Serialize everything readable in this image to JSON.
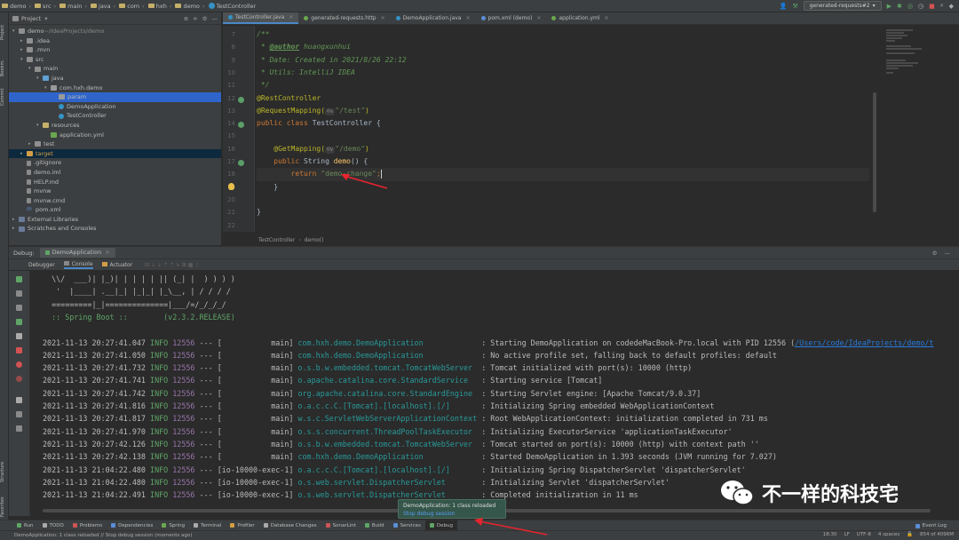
{
  "navbar": {
    "crumbs": [
      "demo",
      "src",
      "main",
      "java",
      "com",
      "hxh",
      "demo",
      "TestController"
    ],
    "run_config": "generated-requests#2"
  },
  "left_stripe": {
    "project": "Project",
    "bookmarks": "Bookmarks",
    "commit": "Commit",
    "structure": "Structure",
    "favorites": "Favorites"
  },
  "project_panel": {
    "title": "Project",
    "tree": [
      {
        "label": "demo",
        "suffix": " ~/IdeaProjects/demo",
        "indent": 0,
        "arrow": "v",
        "icon": "folder"
      },
      {
        "label": ".idea",
        "indent": 1,
        "arrow": ">",
        "icon": "folder"
      },
      {
        "label": ".mvn",
        "indent": 1,
        "arrow": ">",
        "icon": "folder"
      },
      {
        "label": "src",
        "indent": 1,
        "arrow": "v",
        "icon": "folder"
      },
      {
        "label": "main",
        "indent": 2,
        "arrow": "v",
        "icon": "folder"
      },
      {
        "label": "java",
        "indent": 3,
        "arrow": "v",
        "icon": "src"
      },
      {
        "label": "com.hxh.demo",
        "indent": 4,
        "arrow": "v",
        "icon": "pkg"
      },
      {
        "label": "param",
        "indent": 5,
        "arrow": "",
        "icon": "pkg",
        "selected": true
      },
      {
        "label": "DemoApplication",
        "indent": 5,
        "arrow": "",
        "icon": "cls"
      },
      {
        "label": "TestController",
        "indent": 5,
        "arrow": "",
        "icon": "cls"
      },
      {
        "label": "resources",
        "indent": 3,
        "arrow": "v",
        "icon": "res"
      },
      {
        "label": "application.yml",
        "indent": 4,
        "arrow": "",
        "icon": "yml"
      },
      {
        "label": "test",
        "indent": 2,
        "arrow": ">",
        "icon": "folder"
      },
      {
        "label": "target",
        "indent": 1,
        "arrow": ">",
        "icon": "target",
        "highlight": true
      },
      {
        "label": ".gitignore",
        "indent": 1,
        "arrow": "",
        "icon": "file"
      },
      {
        "label": "demo.iml",
        "indent": 1,
        "arrow": "",
        "icon": "file"
      },
      {
        "label": "HELP.md",
        "indent": 1,
        "arrow": "",
        "icon": "file"
      },
      {
        "label": "mvnw",
        "indent": 1,
        "arrow": "",
        "icon": "file"
      },
      {
        "label": "mvnw.cmd",
        "indent": 1,
        "arrow": "",
        "icon": "file"
      },
      {
        "label": "pom.xml",
        "indent": 1,
        "arrow": "",
        "icon": "m"
      },
      {
        "label": "External Libraries",
        "indent": 0,
        "arrow": ">",
        "icon": "lib"
      },
      {
        "label": "Scratches and Consoles",
        "indent": 0,
        "arrow": ">",
        "icon": "lib"
      }
    ]
  },
  "editor": {
    "tabs": [
      {
        "label": "TestController.java",
        "active": true
      },
      {
        "label": "generated-requests.http"
      },
      {
        "label": "DemoApplication.java"
      },
      {
        "label": "pom.xml (demo)"
      },
      {
        "label": "application.yml"
      }
    ],
    "lines": [
      {
        "n": "7",
        "html": "/**",
        "cls": "doc"
      },
      {
        "n": "8",
        "parts": [
          [
            " * ",
            "c-doc"
          ],
          [
            "@author",
            "c-tag"
          ],
          [
            " huangxunhui",
            "c-doc"
          ]
        ]
      },
      {
        "n": "9",
        "parts": [
          [
            " * Date: Created in 2021/8/26 22:12",
            "c-doc"
          ]
        ]
      },
      {
        "n": "10",
        "parts": [
          [
            " * Utils: IntelliJ IDEA",
            "c-doc"
          ]
        ]
      },
      {
        "n": "11",
        "parts": [
          [
            " */",
            "c-doc"
          ]
        ]
      },
      {
        "n": "12",
        "parts": [
          [
            "@RestController",
            "c-ann"
          ]
        ],
        "gutter": true
      },
      {
        "n": "13",
        "parts": [
          [
            "@RequestMapping(",
            "c-ann"
          ],
          [
            "©∨",
            "c-hint"
          ],
          [
            "\"/test\"",
            "c-str"
          ],
          [
            ")",
            "c-ann"
          ]
        ]
      },
      {
        "n": "14",
        "parts": [
          [
            "public class ",
            "c-kw"
          ],
          [
            "TestController {",
            "c-id"
          ]
        ],
        "gutter": true
      },
      {
        "n": "15",
        "parts": [
          [
            "",
            "c-id"
          ]
        ]
      },
      {
        "n": "16",
        "parts": [
          [
            "    @GetMapping(",
            "c-ann"
          ],
          [
            "©∨",
            "c-hint"
          ],
          [
            "\"/demo\"",
            "c-str"
          ],
          [
            ")",
            "c-ann"
          ]
        ]
      },
      {
        "n": "17",
        "parts": [
          [
            "    public ",
            "c-kw"
          ],
          [
            "String ",
            "c-id"
          ],
          [
            "demo",
            "c-fn"
          ],
          [
            "() {",
            "c-id"
          ]
        ],
        "gutter": true
      },
      {
        "n": "18",
        "parts": [
          [
            "        return ",
            "c-kw"
          ],
          [
            "\"demo-change\"",
            "c-str"
          ],
          [
            ";",
            "c-kw"
          ]
        ],
        "current": true
      },
      {
        "n": "19",
        "parts": [
          [
            "    }",
            "c-id"
          ]
        ]
      },
      {
        "n": "20",
        "parts": [
          [
            "",
            "c-id"
          ]
        ]
      },
      {
        "n": "21",
        "parts": [
          [
            "}",
            "c-id"
          ]
        ]
      },
      {
        "n": "22",
        "parts": [
          [
            "",
            "c-id"
          ]
        ]
      }
    ],
    "breadcrumb": [
      "TestController",
      "demo()"
    ]
  },
  "debug": {
    "label": "Debug:",
    "session": "DemoApplication",
    "subtabs": [
      "Debugger",
      "Console",
      "Actuator"
    ],
    "banner": [
      "  \\\\/  ___)| |_)| | | | | || (_| |  ) ) ) )",
      "   '  |____| .__|_| |_|_| |_\\__, | / / / /",
      "  =========|_|==============|___/=/_/_/_/",
      "  :: Spring Boot ::        (v2.3.2.RELEASE)"
    ],
    "logs": [
      {
        "ts": "2021-11-13 20:27:41.047",
        "lvl": "INFO",
        "pid": "12556",
        "thread": "[           main]",
        "logger": "com.hxh.demo.DemoApplication            ",
        "msg": ": Starting DemoApplication on codedeMacBook-Pro.local with PID 12556 (",
        "link": "/Users/code/IdeaProjects/demo/t"
      },
      {
        "ts": "2021-11-13 20:27:41.050",
        "lvl": "INFO",
        "pid": "12556",
        "thread": "[           main]",
        "logger": "com.hxh.demo.DemoApplication            ",
        "msg": ": No active profile set, falling back to default profiles: default"
      },
      {
        "ts": "2021-11-13 20:27:41.732",
        "lvl": "INFO",
        "pid": "12556",
        "thread": "[           main]",
        "logger": "o.s.b.w.embedded.tomcat.TomcatWebServer ",
        "msg": ": Tomcat initialized with port(s): 10000 (http)"
      },
      {
        "ts": "2021-11-13 20:27:41.741",
        "lvl": "INFO",
        "pid": "12556",
        "thread": "[           main]",
        "logger": "o.apache.catalina.core.StandardService  ",
        "msg": ": Starting service [Tomcat]"
      },
      {
        "ts": "2021-11-13 20:27:41.742",
        "lvl": "INFO",
        "pid": "12556",
        "thread": "[           main]",
        "logger": "org.apache.catalina.core.StandardEngine ",
        "msg": ": Starting Servlet engine: [Apache Tomcat/9.0.37]"
      },
      {
        "ts": "2021-11-13 20:27:41.816",
        "lvl": "INFO",
        "pid": "12556",
        "thread": "[           main]",
        "logger": "o.a.c.c.C.[Tomcat].[localhost].[/]      ",
        "msg": ": Initializing Spring embedded WebApplicationContext"
      },
      {
        "ts": "2021-11-13 20:27:41.817",
        "lvl": "INFO",
        "pid": "12556",
        "thread": "[           main]",
        "logger": "w.s.c.ServletWebServerApplicationContext",
        "msg": ": Root WebApplicationContext: initialization completed in 731 ms"
      },
      {
        "ts": "2021-11-13 20:27:41.970",
        "lvl": "INFO",
        "pid": "12556",
        "thread": "[           main]",
        "logger": "o.s.s.concurrent.ThreadPoolTaskExecutor ",
        "msg": ": Initializing ExecutorService 'applicationTaskExecutor'"
      },
      {
        "ts": "2021-11-13 20:27:42.126",
        "lvl": "INFO",
        "pid": "12556",
        "thread": "[           main]",
        "logger": "o.s.b.w.embedded.tomcat.TomcatWebServer ",
        "msg": ": Tomcat started on port(s): 10000 (http) with context path ''"
      },
      {
        "ts": "2021-11-13 20:27:42.138",
        "lvl": "INFO",
        "pid": "12556",
        "thread": "[           main]",
        "logger": "com.hxh.demo.DemoApplication            ",
        "msg": ": Started DemoApplication in 1.393 seconds (JVM running for 7.027)"
      },
      {
        "ts": "2021-11-13 21:04:22.480",
        "lvl": "INFO",
        "pid": "12556",
        "thread": "[io-10000-exec-1]",
        "logger": "o.a.c.c.C.[Tomcat].[localhost].[/]      ",
        "msg": ": Initializing Spring DispatcherServlet 'dispatcherServlet'"
      },
      {
        "ts": "2021-11-13 21:04:22.480",
        "lvl": "INFO",
        "pid": "12556",
        "thread": "[io-10000-exec-1]",
        "logger": "o.s.web.servlet.DispatcherServlet       ",
        "msg": ": Initializing Servlet 'dispatcherServlet'"
      },
      {
        "ts": "2021-11-13 21:04:22.491",
        "lvl": "INFO",
        "pid": "12556",
        "thread": "[io-10000-exec-1]",
        "logger": "o.s.web.servlet.DispatcherServlet       ",
        "msg": ": Completed initialization in 11 ms"
      }
    ]
  },
  "bottom_tools": [
    {
      "label": "Run",
      "color": "#5fa567"
    },
    {
      "label": "TODO",
      "color": "#aaaaaa"
    },
    {
      "label": "Problems",
      "color": "#cc5555"
    },
    {
      "label": "Dependencies",
      "color": "#5b8dd6"
    },
    {
      "label": "Spring",
      "color": "#6aa84f"
    },
    {
      "label": "Terminal",
      "color": "#aaaaaa"
    },
    {
      "label": "Profiler",
      "color": "#d49e46"
    },
    {
      "label": "Database Changes",
      "color": "#aaaaaa"
    },
    {
      "label": "SonarLint",
      "color": "#cc5555"
    },
    {
      "label": "Build",
      "color": "#5fa567"
    },
    {
      "label": "Services",
      "color": "#5b8dd6"
    },
    {
      "label": "Debug",
      "color": "#5fa567",
      "active": true
    }
  ],
  "event_log": "Event Log",
  "status": {
    "message": "DemoApplication: 1 class reloaded // Stop debug session (moments ago)",
    "position": "18:30",
    "line_sep": "LF",
    "encoding": "UTF-8",
    "indent": "4 spaces",
    "memory": "854 of 4096M"
  },
  "balloon": {
    "message": "DemoApplication: 1 class reloaded",
    "action": "Stop debug session"
  },
  "watermark": {
    "text": "不一样的科技宅"
  },
  "colors": {
    "arrow": "#e8242e",
    "accent": "#4a88c7"
  }
}
